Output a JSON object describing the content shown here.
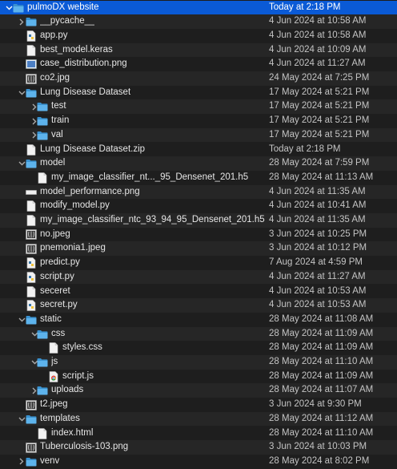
{
  "rows": [
    {
      "name": "pulmoDX website",
      "date": "Today at 2:18 PM",
      "depth": 0,
      "kind": "folder",
      "disclosure": "open",
      "selected": true
    },
    {
      "name": "__pycache__",
      "date": "4 Jun 2024 at 10:58 AM",
      "depth": 1,
      "kind": "folder",
      "disclosure": "closed"
    },
    {
      "name": "app.py",
      "date": "4 Jun 2024 at 10:58 AM",
      "depth": 1,
      "kind": "python"
    },
    {
      "name": "best_model.keras",
      "date": "4 Jun 2024 at 10:09 AM",
      "depth": 1,
      "kind": "file"
    },
    {
      "name": "case_distribution.png",
      "date": "4 Jun 2024 at 11:27 AM",
      "depth": 1,
      "kind": "image-blue"
    },
    {
      "name": "co2.jpg",
      "date": "24 May 2024 at 7:25 PM",
      "depth": 1,
      "kind": "image-xray"
    },
    {
      "name": "Lung Disease Dataset",
      "date": "17 May 2024 at 5:21 PM",
      "depth": 1,
      "kind": "folder",
      "disclosure": "open"
    },
    {
      "name": "test",
      "date": "17 May 2024 at 5:21 PM",
      "depth": 2,
      "kind": "folder",
      "disclosure": "closed"
    },
    {
      "name": "train",
      "date": "17 May 2024 at 5:21 PM",
      "depth": 2,
      "kind": "folder",
      "disclosure": "closed"
    },
    {
      "name": "val",
      "date": "17 May 2024 at 5:21 PM",
      "depth": 2,
      "kind": "folder",
      "disclosure": "closed"
    },
    {
      "name": "Lung Disease Dataset.zip",
      "date": "Today at 2:18 PM",
      "depth": 1,
      "kind": "file"
    },
    {
      "name": "model",
      "date": "28 May 2024 at 7:59 PM",
      "depth": 1,
      "kind": "folder",
      "disclosure": "open"
    },
    {
      "name": "my_image_classifier_nt..._95_Densenet_201.h5",
      "date": "28 May 2024 at 11:13 AM",
      "depth": 2,
      "kind": "file"
    },
    {
      "name": "model_performance.png",
      "date": "4 Jun 2024 at 11:35 AM",
      "depth": 1,
      "kind": "image-wide"
    },
    {
      "name": "modify_model.py",
      "date": "4 Jun 2024 at 10:41 AM",
      "depth": 1,
      "kind": "file"
    },
    {
      "name": "my_image_classifier_ntc_93_94_95_Densenet_201.h5",
      "date": "4 Jun 2024 at 11:35 AM",
      "depth": 1,
      "kind": "file"
    },
    {
      "name": "no.jpeg",
      "date": "3 Jun 2024 at 10:25 PM",
      "depth": 1,
      "kind": "image-xray"
    },
    {
      "name": "pnemonia1.jpeg",
      "date": "3 Jun 2024 at 10:12 PM",
      "depth": 1,
      "kind": "image-xray"
    },
    {
      "name": "predict.py",
      "date": "7 Aug 2024 at 4:59 PM",
      "depth": 1,
      "kind": "python"
    },
    {
      "name": "script.py",
      "date": "4 Jun 2024 at 11:27 AM",
      "depth": 1,
      "kind": "python"
    },
    {
      "name": "seceret",
      "date": "4 Jun 2024 at 10:53 AM",
      "depth": 1,
      "kind": "file"
    },
    {
      "name": "secret.py",
      "date": "4 Jun 2024 at 10:53 AM",
      "depth": 1,
      "kind": "python"
    },
    {
      "name": "static",
      "date": "28 May 2024 at 11:08 AM",
      "depth": 1,
      "kind": "folder",
      "disclosure": "open"
    },
    {
      "name": "css",
      "date": "28 May 2024 at 11:09 AM",
      "depth": 2,
      "kind": "folder",
      "disclosure": "open"
    },
    {
      "name": "styles.css",
      "date": "28 May 2024 at 11:09 AM",
      "depth": 3,
      "kind": "file"
    },
    {
      "name": "js",
      "date": "28 May 2024 at 11:10 AM",
      "depth": 2,
      "kind": "folder",
      "disclosure": "open"
    },
    {
      "name": "script.js",
      "date": "28 May 2024 at 11:09 AM",
      "depth": 3,
      "kind": "chrome"
    },
    {
      "name": "uploads",
      "date": "28 May 2024 at 11:07 AM",
      "depth": 2,
      "kind": "folder",
      "disclosure": "closed"
    },
    {
      "name": "t2.jpeg",
      "date": "3 Jun 2024 at 9:30 PM",
      "depth": 1,
      "kind": "image-xray"
    },
    {
      "name": "templates",
      "date": "28 May 2024 at 11:12 AM",
      "depth": 1,
      "kind": "folder",
      "disclosure": "open"
    },
    {
      "name": "index.html",
      "date": "28 May 2024 at 11:10 AM",
      "depth": 2,
      "kind": "file"
    },
    {
      "name": "Tuberculosis-103.png",
      "date": "3 Jun 2024 at 10:03 PM",
      "depth": 1,
      "kind": "image-xray"
    },
    {
      "name": "venv",
      "date": "28 May 2024 at 8:02 PM",
      "depth": 1,
      "kind": "folder",
      "disclosure": "closed"
    }
  ],
  "icon_names": {
    "folder": "folder-icon",
    "python": "python-file-icon",
    "file": "document-icon",
    "image-blue": "image-icon",
    "image-xray": "xray-image-icon",
    "image-wide": "image-icon",
    "chrome": "chrome-icon"
  },
  "colors": {
    "selection": "#0a5ad6",
    "folder": "#4aa3df",
    "background": "#1e1e1e",
    "stripe": "#262626"
  }
}
